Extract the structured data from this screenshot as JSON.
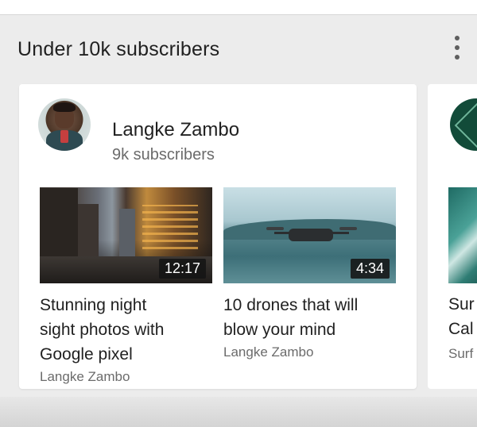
{
  "shelf": {
    "title": "Under 10k subscribers",
    "more_icon": "more-vert-icon"
  },
  "channel_card": {
    "name": "Langke Zambo",
    "subscribers": "9k subscribers",
    "videos": [
      {
        "title_lines": [
          "Stunning night",
          "sight photos with",
          "Google pixel"
        ],
        "channel": "Langke Zambo",
        "duration": "12:17"
      },
      {
        "title_lines": [
          "10 drones that will",
          "blow your mind"
        ],
        "channel": "Langke Zambo",
        "duration": "4:34"
      }
    ]
  },
  "next_card": {
    "title_lines": [
      "Sur",
      "Cal"
    ],
    "channel": "Surf"
  }
}
